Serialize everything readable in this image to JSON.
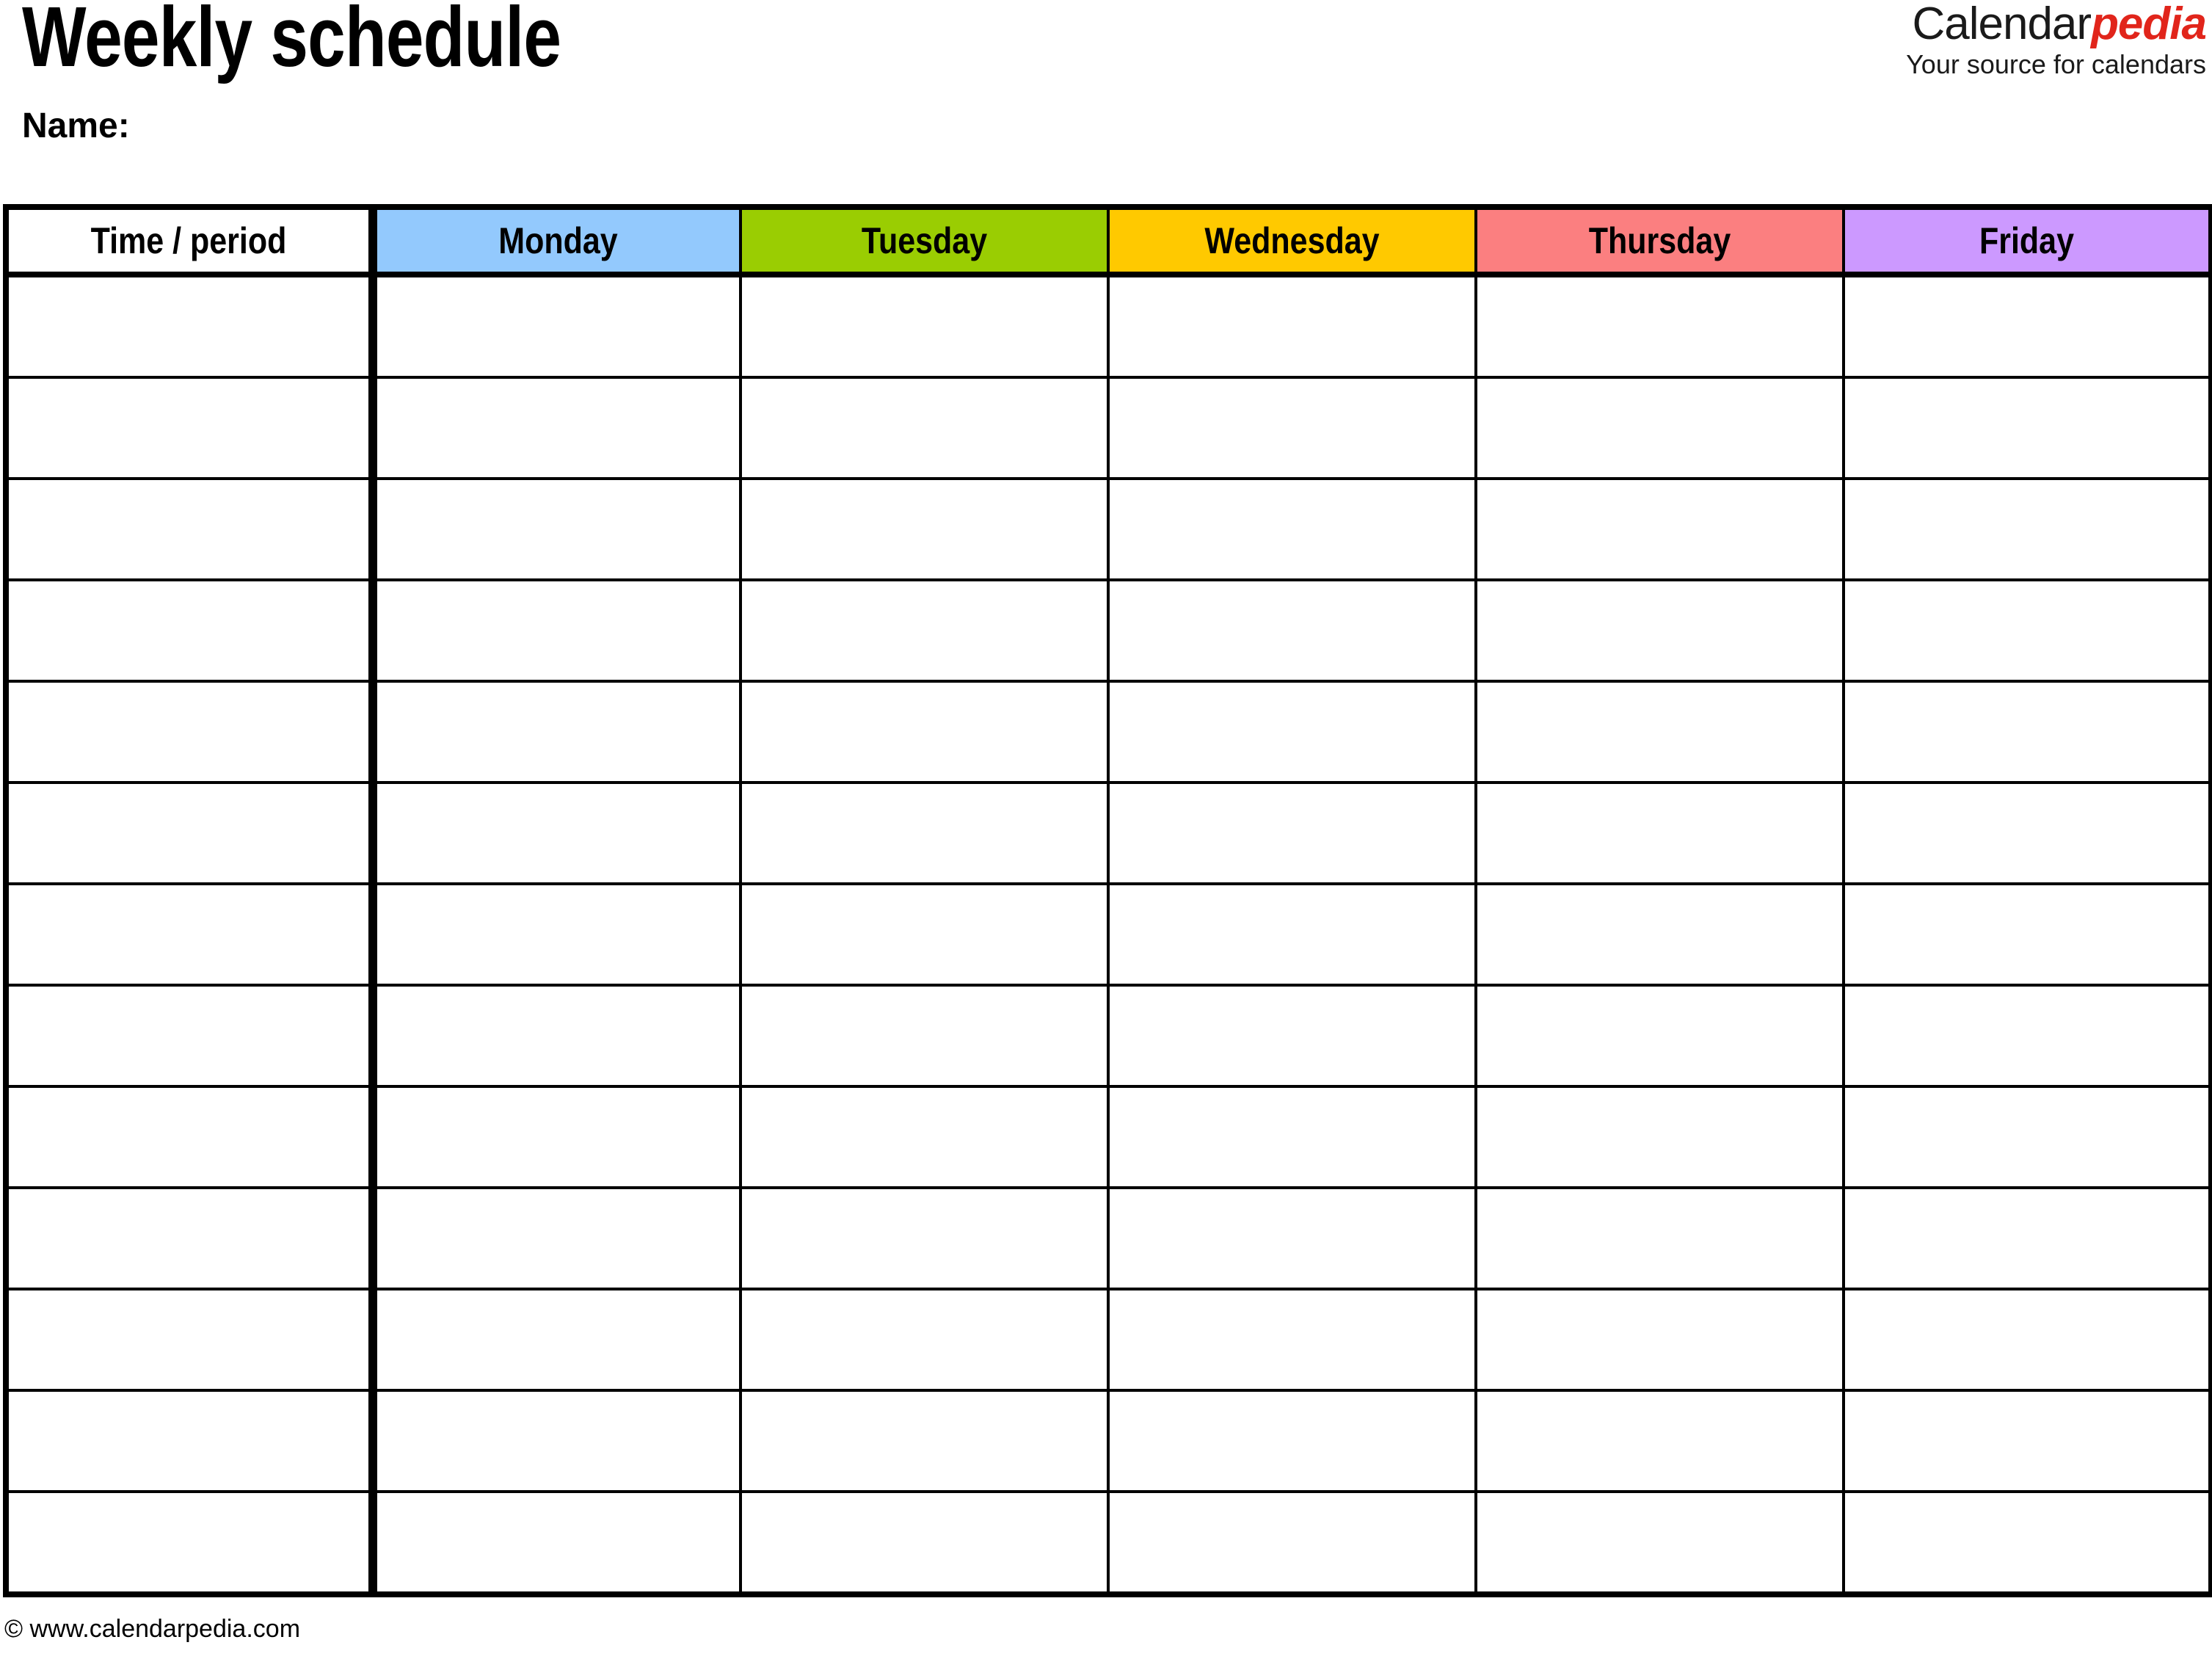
{
  "document": {
    "title": "Weekly schedule",
    "name_label": "Name:"
  },
  "logo": {
    "brand_primary": "Calendar",
    "brand_accent": "pedia",
    "tagline": "Your source for calendars",
    "accent_color": "#E1251B",
    "primary_color": "#1a1a1a"
  },
  "table": {
    "columns": [
      {
        "label": "Time / period",
        "color": "#ffffff",
        "key": "time"
      },
      {
        "label": "Monday",
        "color": "#93C9FD",
        "key": "monday"
      },
      {
        "label": "Tuesday",
        "color": "#9ACD02",
        "key": "tuesday"
      },
      {
        "label": "Wednesday",
        "color": "#FFC900",
        "key": "wednesday"
      },
      {
        "label": "Thursday",
        "color": "#FB7F80",
        "key": "thursday"
      },
      {
        "label": "Friday",
        "color": "#CC99FF",
        "key": "friday"
      }
    ],
    "row_count": 13,
    "rows": [
      {
        "time": "",
        "monday": "",
        "tuesday": "",
        "wednesday": "",
        "thursday": "",
        "friday": ""
      },
      {
        "time": "",
        "monday": "",
        "tuesday": "",
        "wednesday": "",
        "thursday": "",
        "friday": ""
      },
      {
        "time": "",
        "monday": "",
        "tuesday": "",
        "wednesday": "",
        "thursday": "",
        "friday": ""
      },
      {
        "time": "",
        "monday": "",
        "tuesday": "",
        "wednesday": "",
        "thursday": "",
        "friday": ""
      },
      {
        "time": "",
        "monday": "",
        "tuesday": "",
        "wednesday": "",
        "thursday": "",
        "friday": ""
      },
      {
        "time": "",
        "monday": "",
        "tuesday": "",
        "wednesday": "",
        "thursday": "",
        "friday": ""
      },
      {
        "time": "",
        "monday": "",
        "tuesday": "",
        "wednesday": "",
        "thursday": "",
        "friday": ""
      },
      {
        "time": "",
        "monday": "",
        "tuesday": "",
        "wednesday": "",
        "thursday": "",
        "friday": ""
      },
      {
        "time": "",
        "monday": "",
        "tuesday": "",
        "wednesday": "",
        "thursday": "",
        "friday": ""
      },
      {
        "time": "",
        "monday": "",
        "tuesday": "",
        "wednesday": "",
        "thursday": "",
        "friday": ""
      },
      {
        "time": "",
        "monday": "",
        "tuesday": "",
        "wednesday": "",
        "thursday": "",
        "friday": ""
      },
      {
        "time": "",
        "monday": "",
        "tuesday": "",
        "wednesday": "",
        "thursday": "",
        "friday": ""
      },
      {
        "time": "",
        "monday": "",
        "tuesday": "",
        "wednesday": "",
        "thursday": "",
        "friday": ""
      }
    ]
  },
  "footer": {
    "copyright": "© www.calendarpedia.com"
  }
}
